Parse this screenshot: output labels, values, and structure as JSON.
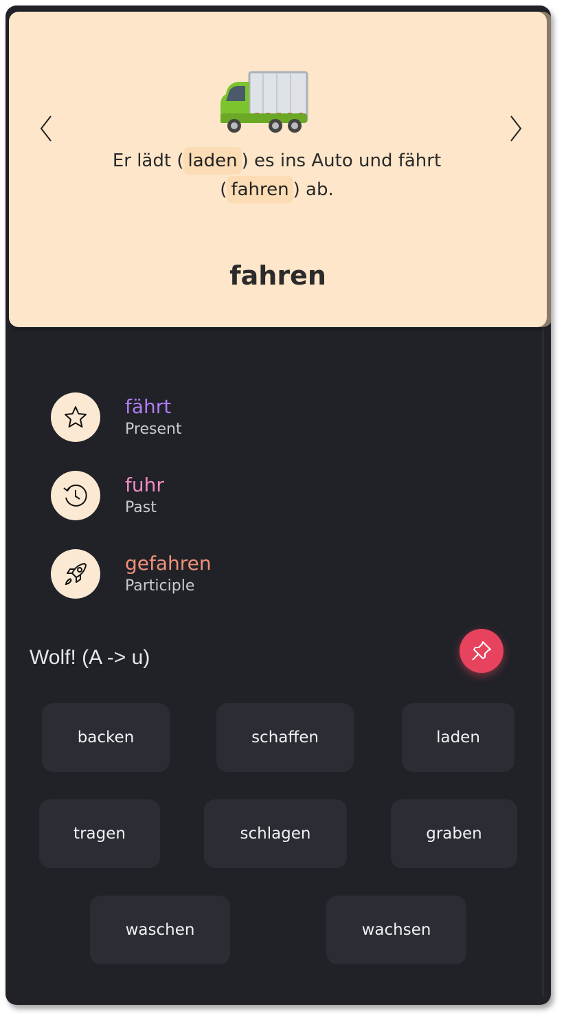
{
  "card": {
    "sentence": {
      "before": "Er lädt",
      "hint1": "laden",
      "middle": "es ins Auto und fährt",
      "hint2": "fahren",
      "after": "ab."
    },
    "infinitive": "fahren",
    "illustration": "truck-emoji",
    "prev_icon": "chevron-left-icon",
    "next_icon": "chevron-right-icon"
  },
  "forms": [
    {
      "value": "fährt",
      "label": "Present",
      "icon": "star-icon",
      "color": "#b07cf2"
    },
    {
      "value": "fuhr",
      "label": "Past",
      "icon": "clock-rewind-icon",
      "color": "#f28ac3"
    },
    {
      "value": "gefahren",
      "label": "Participle",
      "icon": "rocket-icon",
      "color": "#f0907a"
    }
  ],
  "group": {
    "title": "Wolf! (A -> u)",
    "pin_icon": "pin-icon",
    "pin_color": "#e8435e"
  },
  "related_verbs": [
    "backen",
    "schaffen",
    "laden",
    "tragen",
    "schlagen",
    "graben",
    "waschen",
    "wachsen"
  ],
  "colors": {
    "card_background": "#fde6c9",
    "app_background": "#202228",
    "chip_background": "#2a2d34"
  }
}
